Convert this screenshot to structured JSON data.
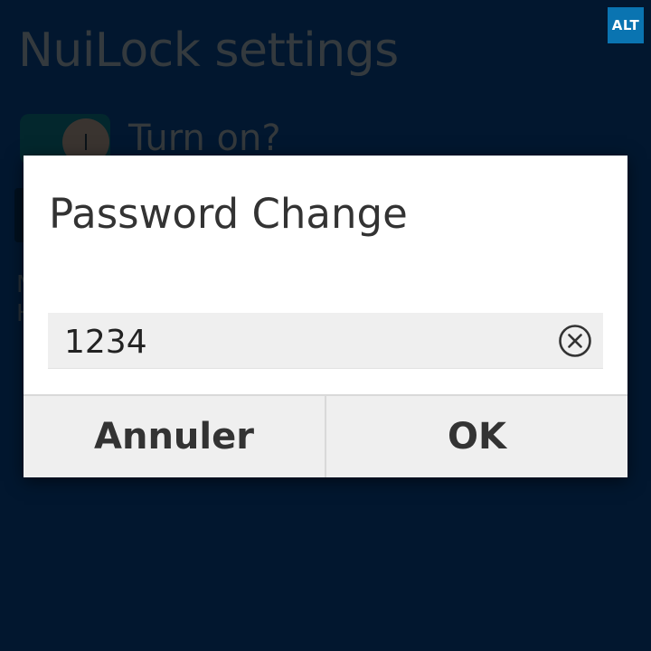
{
  "screen": {
    "title": "NuiLock settings",
    "alt_badge": "ALT",
    "toggle_label": "Turn on?",
    "bg_text_1": "N",
    "bg_text_2": "H"
  },
  "dialog": {
    "title": "Password Change",
    "password_value": "1234",
    "clear_icon": "clear-circle-x-icon",
    "cancel_label": "Annuler",
    "ok_label": "OK"
  },
  "colors": {
    "background": "#02172f",
    "alt_badge": "#0a74b1",
    "dialog_bg": "#ffffff",
    "button_bar": "#efefef"
  }
}
